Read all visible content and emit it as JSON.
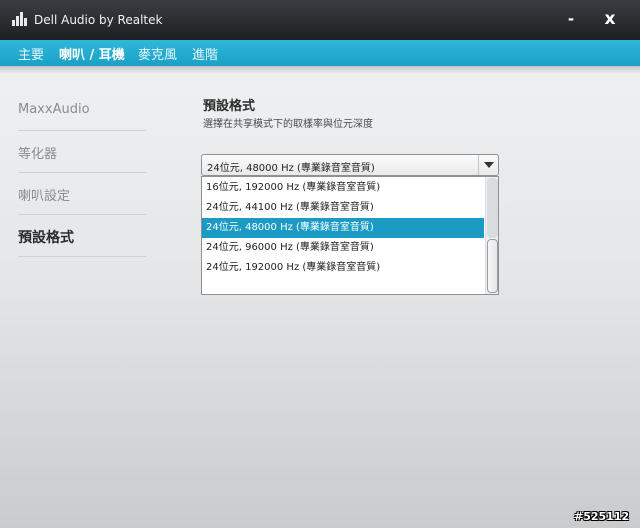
{
  "window": {
    "title": "Dell Audio by Realtek",
    "minimize_label": "-",
    "close_label": "x",
    "icon": "audio-bars-icon"
  },
  "tabs": [
    {
      "label": "主要",
      "active": false
    },
    {
      "label": "喇叭 / 耳機",
      "active": true
    },
    {
      "label": "麥克風",
      "active": false
    },
    {
      "label": "進階",
      "active": false
    }
  ],
  "sidebar": {
    "items": [
      {
        "label": "MaxxAudio",
        "active": false
      },
      {
        "label": "等化器",
        "active": false
      },
      {
        "label": "喇叭設定",
        "active": false
      },
      {
        "label": "預設格式",
        "active": true
      }
    ]
  },
  "main": {
    "title": "預設格式",
    "description": "選擇在共享模式下的取樣率與位元深度",
    "format_select": {
      "value": "24位元, 48000 Hz (專業錄音室音質)",
      "options": [
        "16位元, 192000 Hz (專業錄音室音質)",
        "24位元, 44100 Hz (專業錄音室音質)",
        "24位元, 48000 Hz (專業錄音室音質)",
        "24位元, 96000 Hz (專業錄音室音質)",
        "24位元, 192000 Hz (專業錄音室音質)"
      ],
      "selected_index": 2
    }
  },
  "watermark": "#525112",
  "colors": {
    "accent": "#1aa0c6",
    "selected_option": "#1b9bc4",
    "titlebar": "#1c1f22"
  }
}
